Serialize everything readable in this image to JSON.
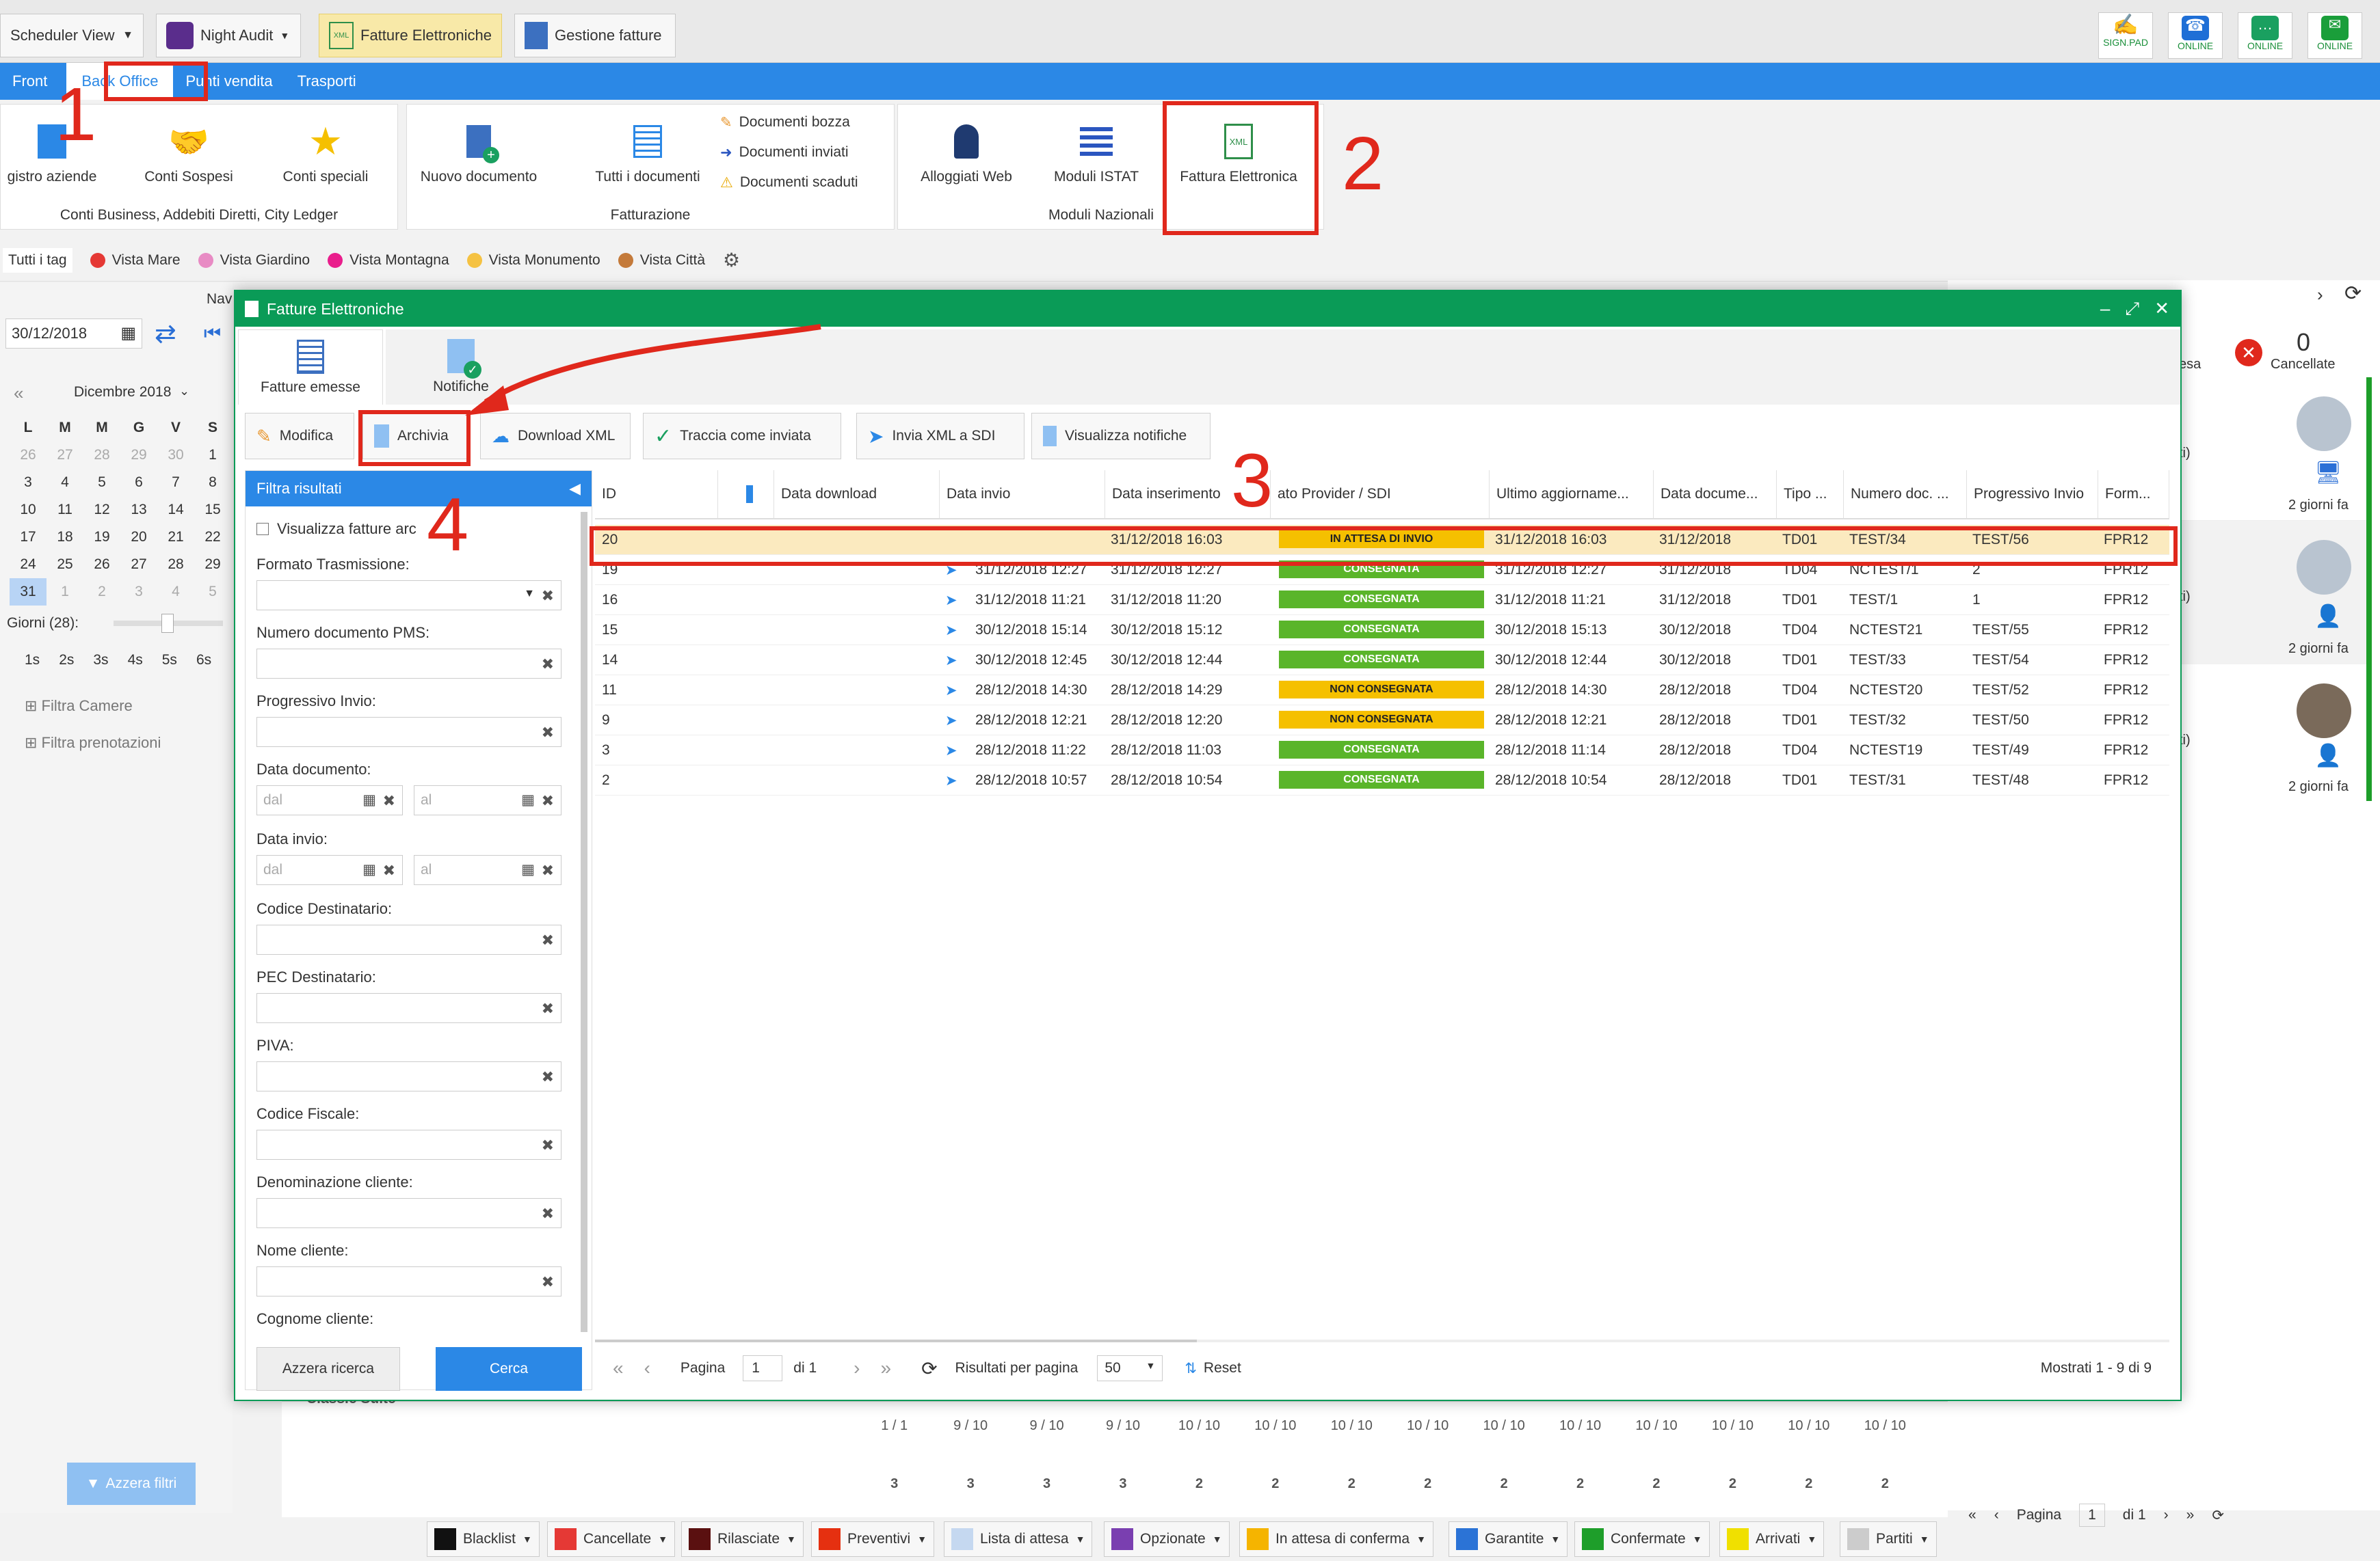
{
  "topbar": {
    "scheduler": "Scheduler View",
    "night_audit": "Night Audit",
    "fatture_btn": "Fatture Elettroniche",
    "gestione_btn": "Gestione fatture",
    "status_icons": [
      "SIGN.PAD",
      "ONLINE",
      "ONLINE",
      "ONLINE"
    ]
  },
  "menu": [
    "Front",
    "Back Office",
    "Punti vendita",
    "Trasporti"
  ],
  "ribbon": {
    "group1": {
      "items": [
        "gistro aziende",
        "Conti Sospesi",
        "Conti speciali"
      ],
      "title": "Conti Business, Addebiti Diretti, City Ledger"
    },
    "group2": {
      "items": [
        "Nuovo documento",
        "Tutti i documenti"
      ],
      "small": [
        "Documenti bozza",
        "Documenti inviati",
        "Documenti scaduti"
      ],
      "title": "Fatturazione"
    },
    "group3": {
      "items": [
        "Alloggiati Web",
        "Moduli ISTAT",
        "Fattura Elettronica"
      ],
      "title": "Moduli Nazionali"
    }
  },
  "tags": {
    "all": "Tutti i tag",
    "items": [
      {
        "label": "Vista Mare",
        "color": "#e53935"
      },
      {
        "label": "Vista Giardino",
        "color": "#e88bc4"
      },
      {
        "label": "Vista Montagna",
        "color": "#e91e8c"
      },
      {
        "label": "Vista Monumento",
        "color": "#f5c242"
      },
      {
        "label": "Vista Città",
        "color": "#c47a3a"
      }
    ]
  },
  "left": {
    "date": "30/12/2018",
    "nav": "Nav",
    "month": "Dicembre 2018",
    "dow": [
      "L",
      "M",
      "M",
      "G",
      "V",
      "S"
    ],
    "weeks": [
      [
        "26",
        "27",
        "28",
        "29",
        "30",
        "1"
      ],
      [
        "3",
        "4",
        "5",
        "6",
        "7",
        "8"
      ],
      [
        "10",
        "11",
        "12",
        "13",
        "14",
        "15"
      ],
      [
        "17",
        "18",
        "19",
        "20",
        "21",
        "22"
      ],
      [
        "24",
        "25",
        "26",
        "27",
        "28",
        "29"
      ],
      [
        "31",
        "1",
        "2",
        "3",
        "4",
        "5"
      ]
    ],
    "giorni": "Giorni (28):",
    "speeds": [
      "1s",
      "2s",
      "3s",
      "4s",
      "5s",
      "6s"
    ],
    "filtra_camere": "Filtra Camere",
    "filtra_pren": "Filtra prenotazioni",
    "azzera": "Azzera filtri"
  },
  "right": {
    "cancel_count": "0",
    "cancel_label": "Cancellate",
    "esa": "esa",
    "ti": "ti)",
    "times": [
      "2 giorni fa",
      "2 giorni fa",
      "2 giorni fa"
    ]
  },
  "modal": {
    "title": "Fatture Elettroniche",
    "tabs": [
      "Fatture emesse",
      "Notifiche"
    ],
    "toolbar": [
      "Modifica",
      "Archivia",
      "Download XML",
      "Traccia come inviata",
      "Invia XML a SDI",
      "Visualizza notifiche"
    ],
    "filter": {
      "title": "Filtra risultati",
      "checkbox": "Visualizza fatture arc",
      "labels": [
        "Formato Trasmissione:",
        "Numero documento PMS:",
        "Progressivo Invio:",
        "Data documento:",
        "Data invio:",
        "Codice Destinatario:",
        "PEC Destinatario:",
        "PIVA:",
        "Codice Fiscale:",
        "Denominazione cliente:",
        "Nome cliente:",
        "Cognome cliente:"
      ],
      "dal": "dal",
      "al": "al",
      "reset": "Azzera ricerca",
      "search": "Cerca"
    },
    "columns": [
      "ID",
      "",
      "Data download",
      "Data invio",
      "Data inserimento",
      "ato Provider / SDI",
      "Ultimo aggiorname...",
      "Data docume...",
      "Tipo ...",
      "Numero doc. ...",
      "Progressivo Invio",
      "Form..."
    ],
    "rows": [
      {
        "id": "20",
        "invio": "",
        "ins": "31/12/2018 16:03",
        "stato": "IN ATTESA DI INVIO",
        "agg": "31/12/2018 16:03",
        "doc": "31/12/2018",
        "tipo": "TD01",
        "num": "TEST/34",
        "prog": "TEST/56",
        "form": "FPR12"
      },
      {
        "id": "19",
        "invio": "31/12/2018 12:27",
        "ins": "31/12/2018 12:27",
        "stato": "CONSEGNATA",
        "agg": "31/12/2018 12:27",
        "doc": "31/12/2018",
        "tipo": "TD04",
        "num": "NCTEST/1",
        "prog": "2",
        "form": "FPR12"
      },
      {
        "id": "16",
        "invio": "31/12/2018 11:21",
        "ins": "31/12/2018 11:20",
        "stato": "CONSEGNATA",
        "agg": "31/12/2018 11:21",
        "doc": "31/12/2018",
        "tipo": "TD01",
        "num": "TEST/1",
        "prog": "1",
        "form": "FPR12"
      },
      {
        "id": "15",
        "invio": "30/12/2018 15:14",
        "ins": "30/12/2018 15:12",
        "stato": "CONSEGNATA",
        "agg": "30/12/2018 15:13",
        "doc": "30/12/2018",
        "tipo": "TD04",
        "num": "NCTEST21",
        "prog": "TEST/55",
        "form": "FPR12"
      },
      {
        "id": "14",
        "invio": "30/12/2018 12:45",
        "ins": "30/12/2018 12:44",
        "stato": "CONSEGNATA",
        "agg": "30/12/2018 12:44",
        "doc": "30/12/2018",
        "tipo": "TD01",
        "num": "TEST/33",
        "prog": "TEST/54",
        "form": "FPR12"
      },
      {
        "id": "11",
        "invio": "28/12/2018 14:30",
        "ins": "28/12/2018 14:29",
        "stato": "NON CONSEGNATA",
        "agg": "28/12/2018 14:30",
        "doc": "28/12/2018",
        "tipo": "TD04",
        "num": "NCTEST20",
        "prog": "TEST/52",
        "form": "FPR12"
      },
      {
        "id": "9",
        "invio": "28/12/2018 12:21",
        "ins": "28/12/2018 12:20",
        "stato": "NON CONSEGNATA",
        "agg": "28/12/2018 12:21",
        "doc": "28/12/2018",
        "tipo": "TD01",
        "num": "TEST/32",
        "prog": "TEST/50",
        "form": "FPR12"
      },
      {
        "id": "3",
        "invio": "28/12/2018 11:22",
        "ins": "28/12/2018 11:03",
        "stato": "CONSEGNATA",
        "agg": "28/12/2018 11:14",
        "doc": "28/12/2018",
        "tipo": "TD04",
        "num": "NCTEST19",
        "prog": "TEST/49",
        "form": "FPR12"
      },
      {
        "id": "2",
        "invio": "28/12/2018 10:57",
        "ins": "28/12/2018 10:54",
        "stato": "CONSEGNATA",
        "agg": "28/12/2018 10:54",
        "doc": "28/12/2018",
        "tipo": "TD01",
        "num": "TEST/31",
        "prog": "TEST/48",
        "form": "FPR12"
      }
    ],
    "pager": {
      "pagina": "Pagina",
      "page": "1",
      "di": "di 1",
      "per_page_label": "Risultati per pagina",
      "per_page": "50",
      "reset": "Reset",
      "summary": "Mostrati 1 - 9 di 9"
    }
  },
  "annotations": [
    "1",
    "2",
    "3",
    "4"
  ],
  "legend": [
    {
      "label": "Blacklist",
      "color": "#111111"
    },
    {
      "label": "Cancellate",
      "color": "#e53935"
    },
    {
      "label": "Rilasciate",
      "color": "#5a1010"
    },
    {
      "label": "Preventivi",
      "color": "#e53010"
    },
    {
      "label": "Lista di attesa",
      "color": "#c5d8f0"
    },
    {
      "label": "Opzionate",
      "color": "#7a3fb0"
    },
    {
      "label": "In attesa di conferma",
      "color": "#f5b400"
    },
    {
      "label": "Garantite",
      "color": "#2b73d6"
    },
    {
      "label": "Confermate",
      "color": "#1e9e2a"
    },
    {
      "label": "Arrivati",
      "color": "#f0e000"
    },
    {
      "label": "Partiti",
      "color": "#cccccc"
    }
  ],
  "bottom": {
    "pagina": "Pagina",
    "page": "1",
    "di": "di 1",
    "timeline": [
      "1 / 1",
      "9 / 10",
      "9 / 10",
      "9 / 10",
      "10 / 10",
      "10 / 10",
      "10 / 10",
      "10 / 10",
      "10 / 10",
      "10 / 10",
      "10 / 10",
      "10 / 10",
      "10 / 10",
      "10 / 10"
    ],
    "counts": [
      "3",
      "3",
      "3",
      "3",
      "2",
      "2",
      "2",
      "2",
      "2",
      "2",
      "2",
      "2",
      "2",
      "2"
    ],
    "classic": "Classic Suite"
  }
}
